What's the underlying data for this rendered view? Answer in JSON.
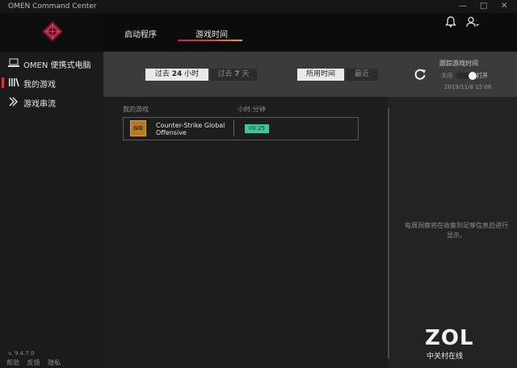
{
  "window": {
    "title": "OMEN Command Center",
    "minimize": "—",
    "restore": "□",
    "close": "✕"
  },
  "sidebar": {
    "items": [
      {
        "label": "OMEN 便携式电脑",
        "icon": "laptop-icon"
      },
      {
        "label": "我的游戏",
        "icon": "game-library-icon",
        "active": true
      },
      {
        "label": "游戏串流",
        "icon": "streaming-icon"
      }
    ],
    "version": "v. 9.4.7.0",
    "links": [
      "帮助",
      "反馈",
      "隐私"
    ]
  },
  "topnav": {
    "tabs": [
      {
        "label": "启动程序"
      },
      {
        "label": "游戏时间",
        "active": true
      }
    ],
    "icons": [
      "bell-icon",
      "user-icon"
    ]
  },
  "controls": {
    "range": {
      "prefix": "过去",
      "h24": "24",
      "unit_h": "小时",
      "d7": "7",
      "unit_d": "天"
    },
    "filter": {
      "all": "所用时间",
      "recent": "最近"
    },
    "track": {
      "title": "跟踪游戏时间",
      "off": "关闭",
      "on": "打开",
      "enabled": true
    },
    "datetime": "2019/11/8 15:06"
  },
  "list": {
    "headers": {
      "game": "我的游戏",
      "time": "小时:分钟"
    },
    "rows": [
      {
        "icon_text": "GO",
        "name": "Counter-Strike Global Offensive",
        "time": "00:25"
      }
    ]
  },
  "rightpanel": {
    "message": "每周洞察将在收集到足够信息后进行显示。"
  },
  "watermark": {
    "brand": "ZOL",
    "sub": "中关村在线"
  },
  "colors": {
    "accent_red": "#e0304a",
    "time_badge": "#3ec79b"
  }
}
